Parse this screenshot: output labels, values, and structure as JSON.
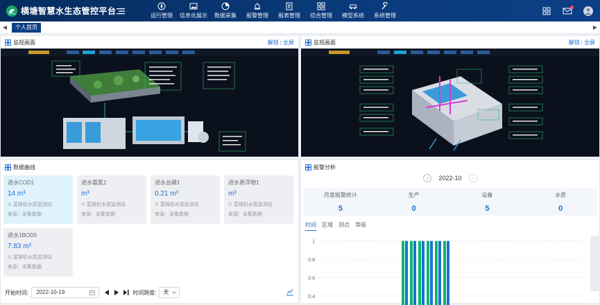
{
  "app": {
    "title": "横塘智慧水生态管控平台"
  },
  "nav": [
    {
      "label": "运行管理",
      "icon": "compass-icon"
    },
    {
      "label": "信息化展示",
      "icon": "image-icon"
    },
    {
      "label": "数据采集",
      "icon": "pie-icon"
    },
    {
      "label": "报警管理",
      "icon": "alarm-icon"
    },
    {
      "label": "报表管理",
      "icon": "report-icon"
    },
    {
      "label": "综合管理",
      "icon": "grid-icon"
    },
    {
      "label": "模型系统",
      "icon": "car-icon"
    },
    {
      "label": "系统管理",
      "icon": "wrench-icon"
    }
  ],
  "tabs": [
    {
      "label": "个人首页",
      "active": true
    }
  ],
  "monitor_left": {
    "title": "监视画面",
    "unlock": "解锁",
    "sep": "|",
    "fullscreen": "全屏"
  },
  "monitor_right": {
    "title": "监视画面",
    "unlock": "解锁",
    "sep": "|",
    "fullscreen": "全屏"
  },
  "data_curve": {
    "title": "数据曲线",
    "cards": [
      {
        "name": "进水COD1",
        "value": "14 m³",
        "location": "富锦杭水质监测站",
        "source": "来源：采集数据",
        "active": true
      },
      {
        "name": "进水氨氮1",
        "value": "m³",
        "location": "富锦杭水质监测站",
        "source": "来源：采集数据",
        "active": false
      },
      {
        "name": "进水总磷1",
        "value": "0.21 m³",
        "location": "富锦杭水质监测站",
        "source": "来源：采集数据",
        "active": false
      },
      {
        "name": "进水悬浮物1",
        "value": "m³",
        "location": "富锦杭水质监测站",
        "source": "来源：采集数据",
        "active": false
      },
      {
        "name": "进水1BOD5",
        "value": "7.83 m³",
        "location": "富锦杭水质监测站",
        "source": "来源：采集数据",
        "active": false
      }
    ],
    "start_label": "开始时间:",
    "start_date": "2022-10-19",
    "granularity_label": "时间跨度:",
    "granularity_value": "天"
  },
  "alarm": {
    "title": "报警分析",
    "month": "2022-10",
    "stats": [
      {
        "label": "月度报警统计",
        "value": "5"
      },
      {
        "label": "生产",
        "value": "0"
      },
      {
        "label": "设备",
        "value": "5"
      },
      {
        "label": "水质",
        "value": "0"
      }
    ],
    "subtabs": [
      "时间",
      "区域",
      "测点",
      "等级"
    ],
    "active_subtab": "时间"
  },
  "chart_data": {
    "type": "bar",
    "title": "",
    "xlabel": "",
    "ylabel": "",
    "ylim": [
      0.3,
      1.05
    ],
    "yticks": [
      "1",
      "0.8",
      "0.6",
      "0.4"
    ],
    "ytick_values": [
      1,
      0.8,
      0.6,
      0.4
    ],
    "series": [
      {
        "values": [
          1,
          1,
          1,
          1,
          1,
          1
        ],
        "color": "#00b96b"
      },
      {
        "values": [
          1,
          1,
          1,
          1,
          1,
          1
        ],
        "color": "#1f6fd1"
      }
    ]
  }
}
